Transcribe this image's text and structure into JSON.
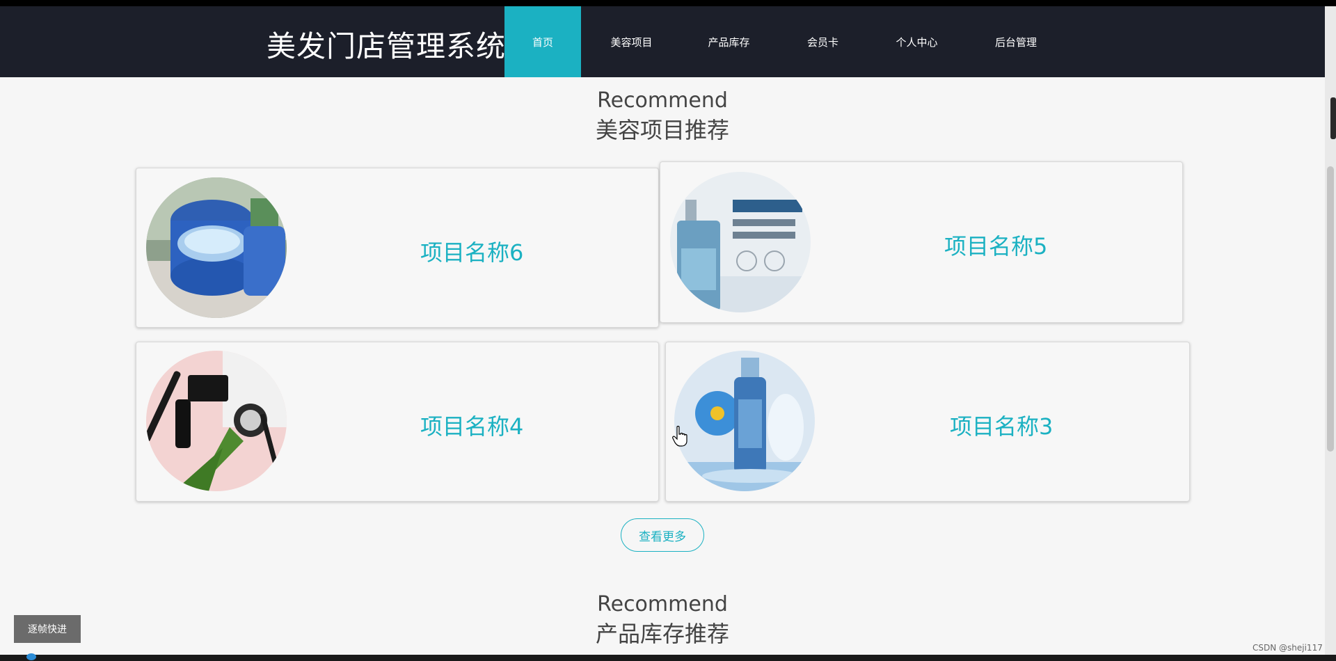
{
  "header": {
    "title": "美发门店管理系统",
    "nav": [
      {
        "label": "首页",
        "active": true
      },
      {
        "label": "美容项目",
        "active": false
      },
      {
        "label": "产品库存",
        "active": false
      },
      {
        "label": "会员卡",
        "active": false
      },
      {
        "label": "个人中心",
        "active": false
      },
      {
        "label": "后台管理",
        "active": false
      }
    ]
  },
  "sections": [
    {
      "en": "Recommend",
      "zh": "美容项目推荐"
    },
    {
      "en": "Recommend",
      "zh": "产品库存推荐"
    }
  ],
  "projects": [
    {
      "name": "项目名称6",
      "image": "cosmetic-jar-image"
    },
    {
      "name": "项目名称5",
      "image": "essence-bottle-image"
    },
    {
      "name": "项目名称4",
      "image": "makeup-tools-image"
    },
    {
      "name": "项目名称3",
      "image": "serum-bottle-image"
    }
  ],
  "more_button": "查看更多",
  "step_button": "逐帧快进",
  "watermark": "CSDN @sheji117",
  "colors": {
    "accent": "#1bb1c2",
    "header_bg": "#1c1f2a",
    "page_bg": "#f6f6f6"
  }
}
